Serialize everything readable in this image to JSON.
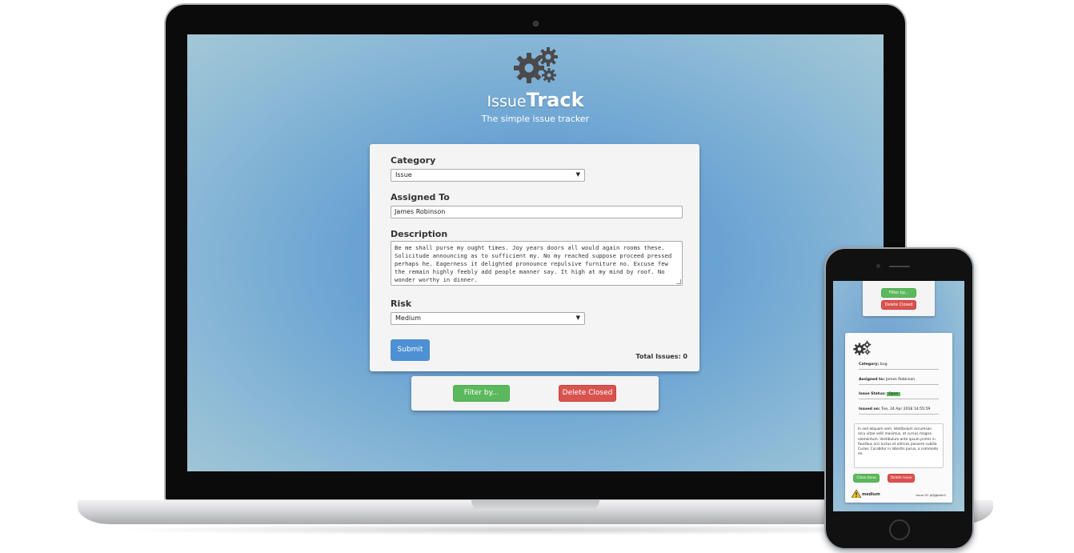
{
  "app": {
    "title_part1": "Issue",
    "title_part2": "Track",
    "subtitle": "The simple issue tracker"
  },
  "form": {
    "category_label": "Category",
    "category_value": "Issue",
    "assigned_label": "Assigned To",
    "assigned_value": "James Robinson",
    "description_label": "Description",
    "description_value": "Be me shall purse my ought times. Joy years doors all would again rooms these. Solicitude announcing as to sufficient my. No my reached suppose proceed pressed perhaps he. Eagerness it delighted pronounce repulsive furniture no. Excuse few the remain highly feebly add people manner say. It high at my mind by roof. No wonder worthy in dinner.",
    "risk_label": "Risk",
    "risk_value": "Medium",
    "submit_label": "Submit",
    "total_issues": "Total Issues: 0"
  },
  "actions": {
    "filter_label": "Filter by...",
    "delete_closed_label": "Delete Closed"
  },
  "mobile": {
    "filter_label": "Filter by...",
    "delete_closed_label": "Delete Closed",
    "issue": {
      "category_label": "Category:",
      "category_value": "bug",
      "assigned_label": "Assigned to:",
      "assigned_value": "James Robinson",
      "status_label": "Issue Status:",
      "status_value": "Open",
      "issued_label": "Issued on:",
      "issued_value": "Tue, 24 Apr 2018 14:55:59",
      "description": "In sed aliquam sem. Vestibulum accumsan arcu vitae velit maximus, at cursus magna elementum. Vestibulum ante ipsum primis in faucibus orci luctus et ultrices posuere cubilia Curae; Curabitur in lobortis purus, a commodo mi.",
      "close_label": "Close Issue",
      "delete_label": "Delete Issue",
      "risk": "medium",
      "issue_id": "Issue ID: gfljjgbmk2"
    }
  },
  "colors": {
    "primary": "#4d90d4",
    "success": "#5cb85c",
    "danger": "#d9534f",
    "background": "#6aa3d3"
  }
}
